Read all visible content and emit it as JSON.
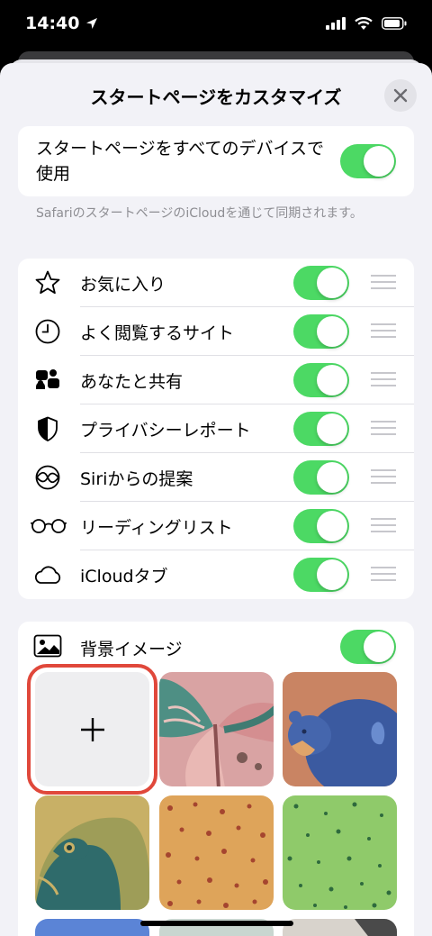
{
  "status_bar": {
    "time": "14:40"
  },
  "sheet": {
    "title": "スタートページをカスタマイズ",
    "sync": {
      "label": "スタートページをすべてのデバイスで使用",
      "enabled": true
    },
    "footnote": "SafariのスタートページのiCloudを通じて同期されます。",
    "sections": [
      {
        "label": "お気に入り",
        "icon": "star-icon",
        "enabled": true
      },
      {
        "label": "よく閲覧するサイト",
        "icon": "clock-icon",
        "enabled": true
      },
      {
        "label": "あなたと共有",
        "icon": "shared-with-you-icon",
        "enabled": true
      },
      {
        "label": "プライバシーレポート",
        "icon": "shield-icon",
        "enabled": true
      },
      {
        "label": "Siriからの提案",
        "icon": "siri-icon",
        "enabled": true
      },
      {
        "label": "リーディングリスト",
        "icon": "glasses-icon",
        "enabled": true
      },
      {
        "label": "iCloudタブ",
        "icon": "cloud-icon",
        "enabled": true
      }
    ],
    "background": {
      "label": "背景イメージ",
      "enabled": true,
      "images": [
        "add-image",
        "butterfly",
        "bear",
        "parrot",
        "orange-pattern",
        "green-pattern"
      ]
    }
  },
  "colors": {
    "toggle_on": "#4cd964",
    "selection_ring": "#e0483b",
    "sheet_bg": "#f2f2f7"
  }
}
